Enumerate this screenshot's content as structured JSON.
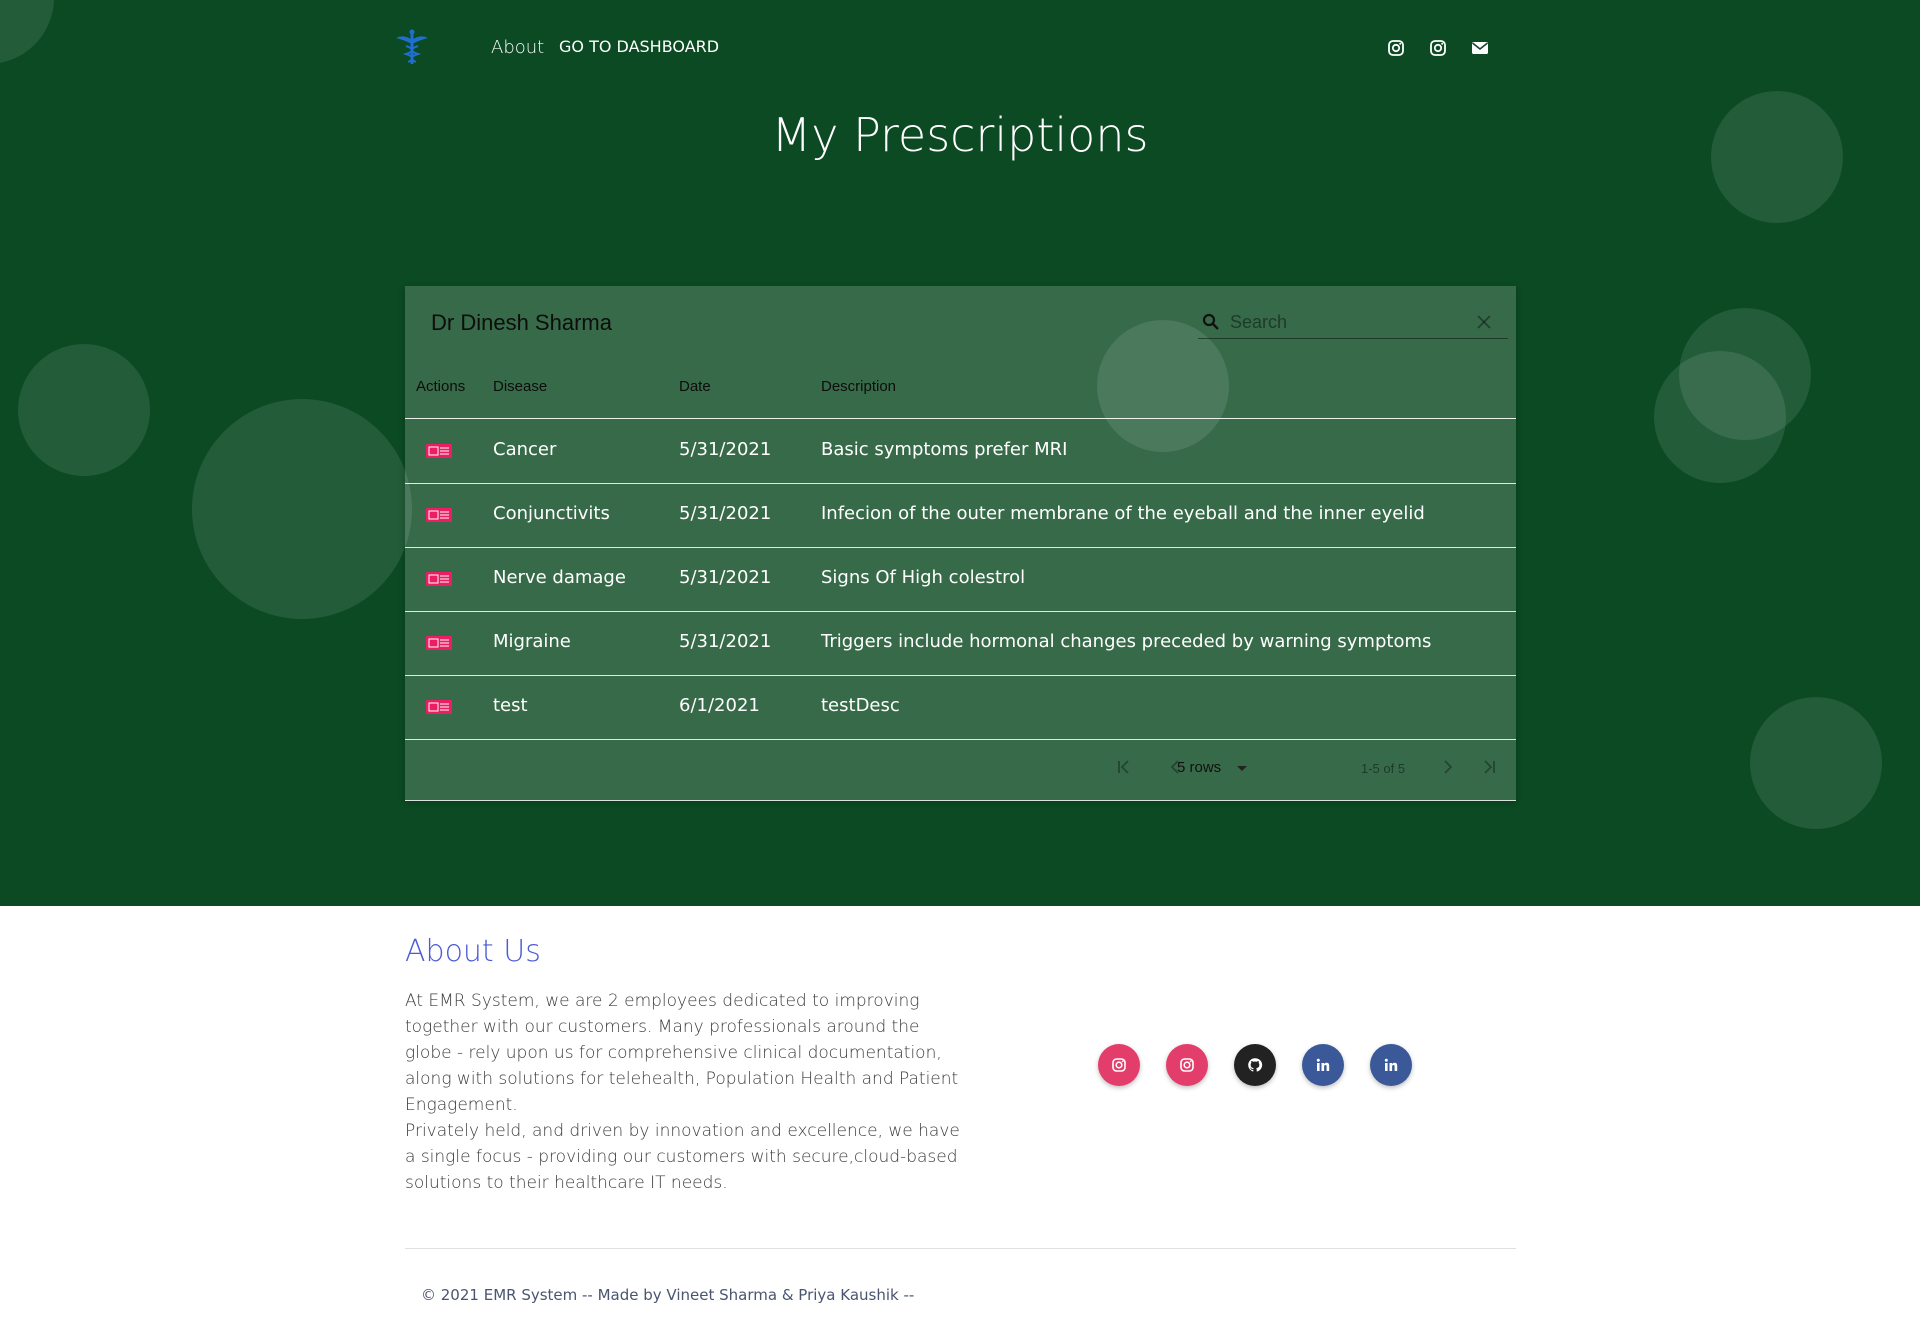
{
  "nav": {
    "about_label": "About",
    "dashboard_label": "GO TO DASHBOARD",
    "icons": [
      "instagram-icon",
      "instagram-icon",
      "envelope-icon"
    ]
  },
  "page": {
    "title": "My Prescriptions"
  },
  "table": {
    "title": "Dr Dinesh Sharma",
    "search_placeholder": "Search",
    "columns": {
      "actions": "Actions",
      "disease": "Disease",
      "date": "Date",
      "description": "Description"
    },
    "rows": [
      {
        "disease": "Cancer",
        "date": "5/31/2021",
        "description": "Basic symptoms prefer MRI"
      },
      {
        "disease": "Conjunctivits",
        "date": "5/31/2021",
        "description": "Infecion of the outer membrane of the eyeball and the inner eyelid"
      },
      {
        "disease": "Nerve damage",
        "date": "5/31/2021",
        "description": "Signs Of High colestrol"
      },
      {
        "disease": "Migraine",
        "date": "5/31/2021",
        "description": "Triggers include hormonal changes preceded by warning symptoms"
      },
      {
        "disease": "test",
        "date": "6/1/2021",
        "description": "testDesc"
      }
    ],
    "pagination": {
      "rows_per_page": "5 rows",
      "info": "1-5 of 5"
    }
  },
  "about": {
    "title": "About Us",
    "paragraph1": "At EMR System, we are 2 employees dedicated to improving together with our customers. Many professionals around the globe - rely upon us for comprehensive clinical documentation, along with solutions for telehealth, Population Health and Patient Engagement.",
    "paragraph2": "Privately held, and driven by innovation and excellence, we have a single focus - providing our customers with secure,cloud-based solutions to their healthcare IT needs.",
    "social": [
      {
        "icon": "instagram-icon",
        "color": "#e23d6b"
      },
      {
        "icon": "instagram-icon",
        "color": "#e23d6b"
      },
      {
        "icon": "github-icon",
        "color": "#222222"
      },
      {
        "icon": "linkedin-icon",
        "color": "#3b5998"
      },
      {
        "icon": "linkedin-icon",
        "color": "#3b5998"
      }
    ]
  },
  "footer": {
    "copyright": "© 2021 EMR System -- Made by Vineet Sharma & Priya Kaushik --"
  },
  "colors": {
    "hero_bg": "#0b4a22",
    "accent": "#4b5bd6",
    "action_icon": "#e91e63"
  }
}
